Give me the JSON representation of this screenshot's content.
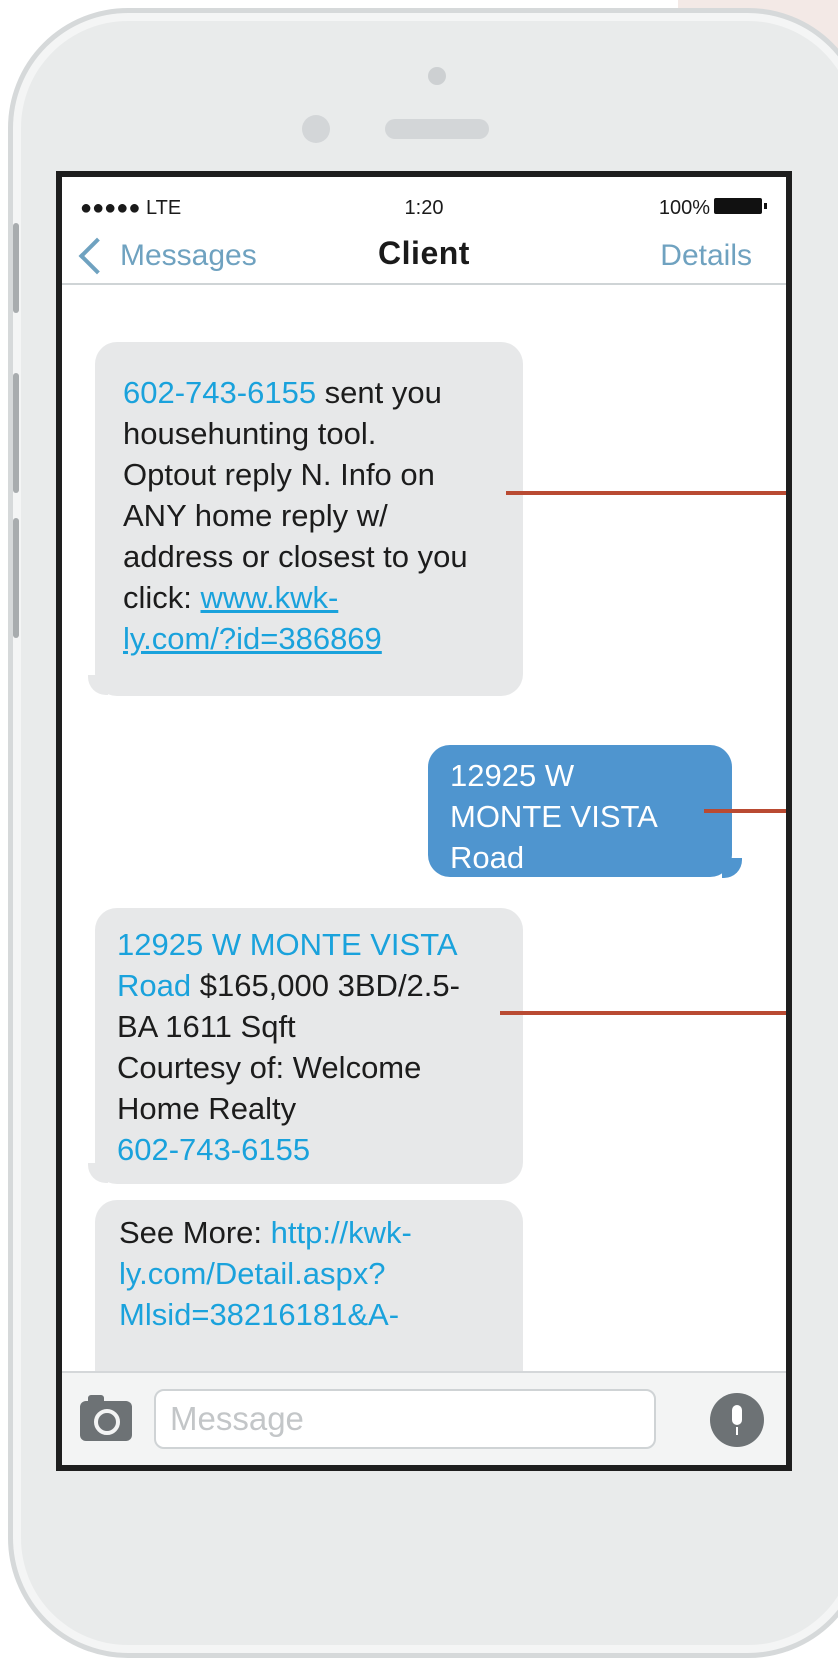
{
  "status_bar": {
    "signal": "●●●●● LTE",
    "time": "1:20",
    "battery_pct": "100%"
  },
  "nav": {
    "back_label": "Messages",
    "title": "Client",
    "details_label": "Details"
  },
  "messages": [
    {
      "direction": "incoming",
      "phone": "602-743-6155",
      "l1_rest": " sent you",
      "l2": "househunting tool.",
      "l3": "Optout reply N. Info on",
      "l4": "ANY home reply w/",
      "l5": "address or closest to you",
      "l6_prefix": "click: ",
      "link_a": "www.kwk-",
      "link_b": "ly.com/?id=386869"
    },
    {
      "direction": "outgoing",
      "l1": "12925 W",
      "l2": "MONTE VISTA",
      "l3": "Road"
    },
    {
      "direction": "incoming",
      "addr_a": "12925 W MONTE VISTA",
      "addr_b": "Road",
      "l2_rest": " $165,000 3BD/2.5-",
      "l3": "BA 1611 Sqft",
      "l4": "Courtesy of: Welcome",
      "l5": "Home Realty",
      "phone": "602-743-6155"
    },
    {
      "direction": "incoming",
      "prefix": "See More: ",
      "link_a": "http://kwk-",
      "link_b": "ly.com/Detail.aspx?",
      "link_c": "Mlsid=38216181&A-"
    }
  ],
  "composer": {
    "placeholder": "Message"
  },
  "colors": {
    "incoming_bubble": "#e7e8e9",
    "outgoing_bubble": "#4f95cf",
    "link": "#1aa2dc",
    "nav_accent": "#6fa2c0",
    "callout_line": "#b94a32"
  },
  "icons": {
    "back": "chevron-left-icon",
    "camera": "camera-icon",
    "mic": "microphone-icon",
    "battery": "battery-icon"
  }
}
